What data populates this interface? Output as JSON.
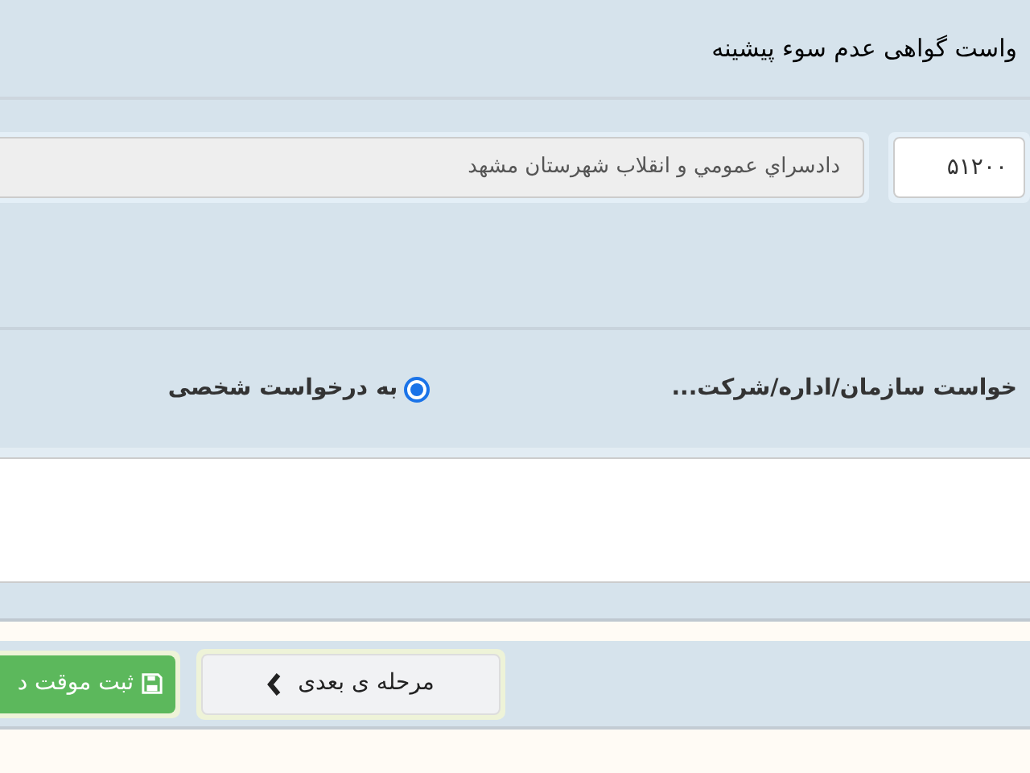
{
  "title": "واست گواهی عدم سوء پیشینه",
  "fields": [
    {
      "kind": "input",
      "value": "۵۱۲۰۰"
    },
    {
      "kind": "readonly",
      "value": "دادسراي عمومي و انقلاب شهرستان مشهد"
    }
  ],
  "request_type": [
    {
      "label": "خواست سازمان/اداره/شرکت..."
    },
    {
      "label": "به درخواست شخصی",
      "selected": true
    }
  ],
  "buttons": [
    {
      "kind": "next",
      "label": "مرحله ی بعدی"
    },
    {
      "kind": "save",
      "label": "ثبت موقت د"
    }
  ]
}
